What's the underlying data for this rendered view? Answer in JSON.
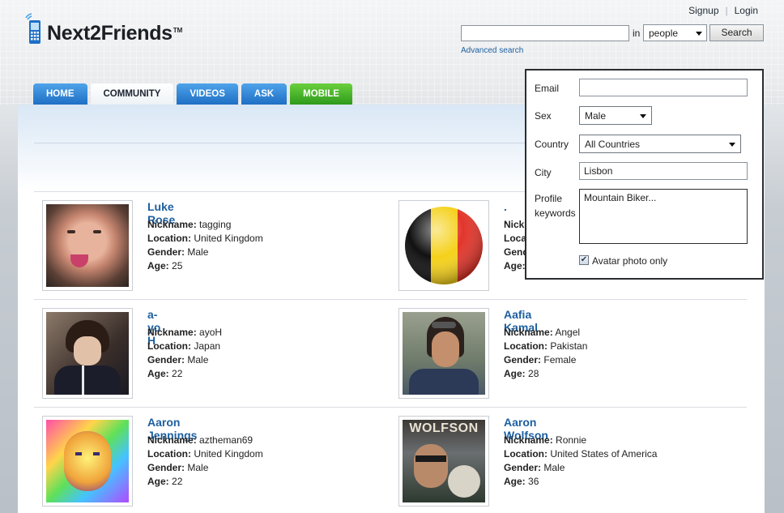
{
  "brand": {
    "name": "Next2Friends",
    "tm": "TM"
  },
  "top_links": {
    "signup": "Signup",
    "login": "Login"
  },
  "search": {
    "value": "",
    "in_label": "in",
    "scope": "people",
    "button": "Search",
    "advanced_link": "Advanced search"
  },
  "nav": {
    "tabs": [
      "HOME",
      "COMMUNITY",
      "VIDEOS",
      "ASK",
      "MOBILE"
    ],
    "active": "COMMUNITY"
  },
  "advanced_search": {
    "email_label": "Email",
    "email_value": "",
    "sex_label": "Sex",
    "sex_value": "Male",
    "country_label": "Country",
    "country_value": "All Countries",
    "city_label": "City",
    "city_value": "Lisbon",
    "keywords_label_line1": "Profile",
    "keywords_label_line2": "keywords",
    "keywords_value": "Mountain Biker...",
    "avatar_only_label": "Avatar photo only",
    "avatar_only_checked": true
  },
  "field_labels": {
    "nickname": "Nickname:",
    "location": "Location:",
    "gender": "Gender:",
    "age": "Age:"
  },
  "members": [
    {
      "name": "Luke Rose",
      "nickname": "tagging",
      "location": "United Kingdom",
      "gender": "Male",
      "age": "25"
    },
    {
      "name": ". .",
      "nickname": "",
      "location": "",
      "gender": "",
      "age": ""
    },
    {
      "name": "a-yo H",
      "nickname": "ayoH",
      "location": "Japan",
      "gender": "Male",
      "age": "22"
    },
    {
      "name": "Aafia Kamal",
      "nickname": "Angel",
      "location": "Pakistan",
      "gender": "Female",
      "age": "28"
    },
    {
      "name": "Aaron Jennings",
      "nickname": "aztheman69",
      "location": "United Kingdom",
      "gender": "Male",
      "age": "22"
    },
    {
      "name": "Aaron Wolfson",
      "nickname": "Ronnie",
      "location": "United States of America",
      "gender": "Male",
      "age": "36",
      "photo_text": "WOLFSON"
    }
  ]
}
